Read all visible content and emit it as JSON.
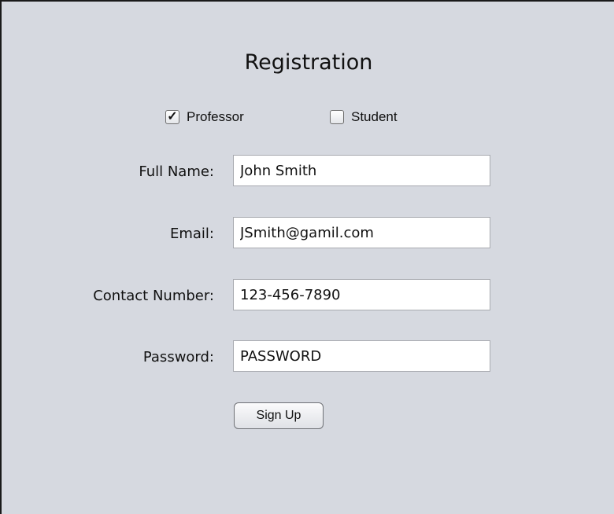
{
  "form": {
    "title": "Registration",
    "roles": [
      {
        "label": "Professor",
        "checked": true
      },
      {
        "label": "Student",
        "checked": false
      }
    ],
    "fields": [
      {
        "label": "Full Name:",
        "value": "John Smith"
      },
      {
        "label": "Email:",
        "value": "JSmith@gamil.com"
      },
      {
        "label": "Contact Number:",
        "value": "123-456-7890"
      },
      {
        "label": "Password:",
        "value": "PASSWORD"
      }
    ],
    "submit_label": "Sign Up"
  }
}
